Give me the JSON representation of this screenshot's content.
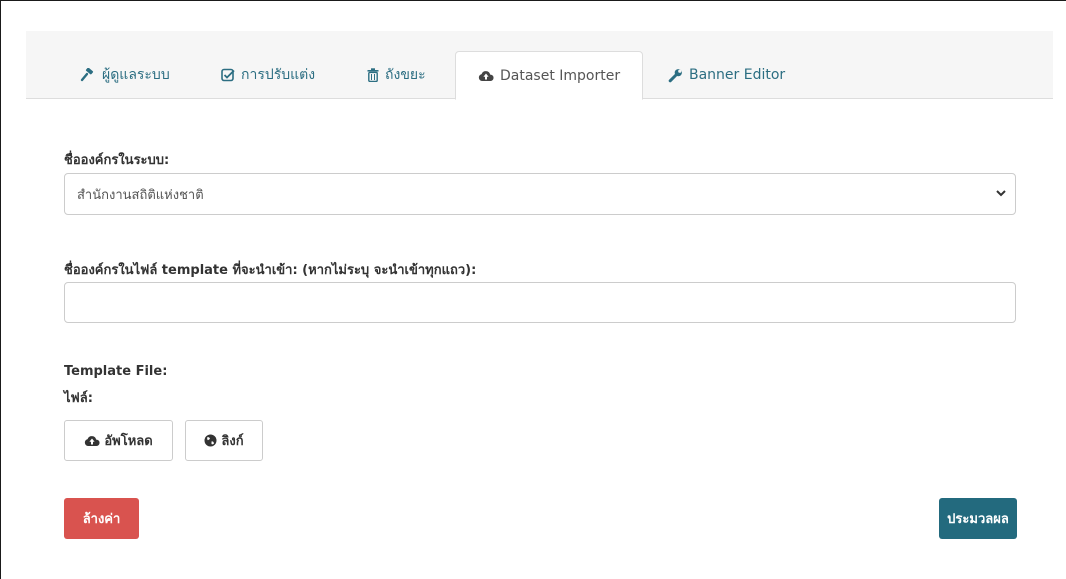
{
  "tabs": [
    {
      "label": "ผู้ดูแลระบบ",
      "icon": "gavel-icon"
    },
    {
      "label": "การปรับแต่ง",
      "icon": "check-square-icon"
    },
    {
      "label": "ถังขยะ",
      "icon": "trash-icon"
    },
    {
      "label": "Dataset Importer",
      "icon": "cloud-upload-icon",
      "active": true
    },
    {
      "label": "Banner Editor",
      "icon": "wrench-icon"
    }
  ],
  "form": {
    "org_label": "ชื่อองค์กรในระบบ:",
    "org_selected": "สำนักงานสถิติแห่งชาติ",
    "template_org_label": "ชื่อองค์กรในไฟล์ template ที่จะนำเข้า: (หากไม่ระบุ จะนำเข้าทุกแถว):",
    "template_org_value": "",
    "template_file_label": "Template File:",
    "file_label": "ไฟล์:",
    "upload_label": "อัพโหลด",
    "link_label": "ลิงก์",
    "clear_label": "ล้างค่า",
    "process_label": "ประมวลผล"
  },
  "colors": {
    "accent": "#2c6e82",
    "danger": "#d9534f",
    "primary": "#236a7e"
  }
}
